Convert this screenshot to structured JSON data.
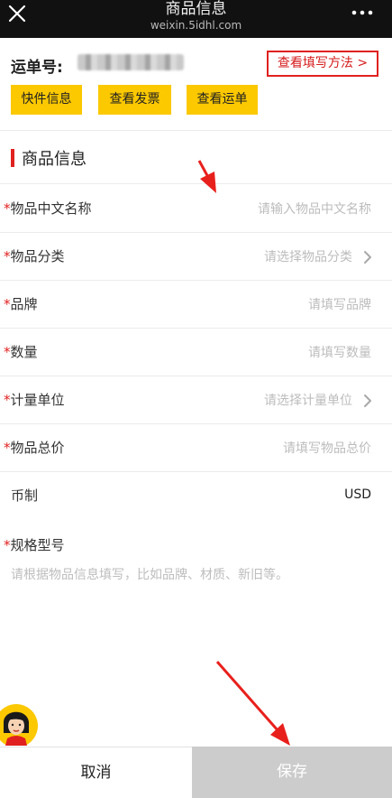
{
  "topbar": {
    "title": "商品信息",
    "subtitle": "weixin.5idhl.com",
    "close_icon": "close-icon",
    "more_icon": "more-icon"
  },
  "waybill": {
    "label": "运单号:",
    "howto_label": "查看填写方法 >",
    "buttons": [
      {
        "label": "快件信息"
      },
      {
        "label": "查看发票"
      },
      {
        "label": "查看运单"
      }
    ]
  },
  "section": {
    "title": "商品信息"
  },
  "fields": [
    {
      "required": "*",
      "label": "物品中文名称",
      "placeholder": "请输入物品中文名称"
    },
    {
      "required": "*",
      "label": "物品分类",
      "placeholder": "请选择物品分类"
    },
    {
      "required": "*",
      "label": "品牌",
      "placeholder": "请填写品牌"
    },
    {
      "required": "*",
      "label": "数量",
      "placeholder": "请填写数量"
    },
    {
      "required": "*",
      "label": "计量单位",
      "placeholder": "请选择计量单位"
    },
    {
      "required": "*",
      "label": "物品总价",
      "placeholder": "请填写物品总价"
    },
    {
      "required": "",
      "label": "币制",
      "value": "USD"
    }
  ],
  "spec": {
    "required": "*",
    "label": "规格型号",
    "placeholder": "请根据物品信息填写，比如品牌、材质、新旧等。"
  },
  "bottom": {
    "cancel_label": "取消",
    "save_label": "保存"
  },
  "colors": {
    "accent_yellow": "#fcc800",
    "required_red": "#e0211f",
    "topbar_bg": "#111111"
  }
}
